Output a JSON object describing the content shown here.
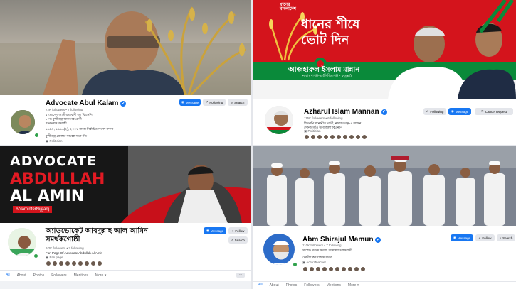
{
  "panels": {
    "p1": {
      "name": "Advocate Abul Kalam",
      "stats": "72K followers • 7 following",
      "bio": [
        "বাংলাদেশ জাতীয়তাবাদী দল বিএনপি",
        "৮ নং মুন্সীগঞ্জ আসনের প্রার্থী",
        "মনোনয়নপ্রত্যাশী"
      ],
      "bio2": "১৯৯১, ১৯৯৬(২), ২০০১ সালে নির্বাচিত সংসদ সদস্য",
      "bio3": "মুন্সীগঞ্জ জেলার সাবেক সভাপতি",
      "category": "Politician",
      "message": "Message",
      "following": "Following",
      "search": "Search"
    },
    "p2": {
      "banner_top": "ধানের শীষে ভোট দিন",
      "banner_name": "আজহারুল ইসলাম মান্নান",
      "banner_sub": "নারায়ণগঞ্জ-৪ (সিদ্ধিরগঞ্জ - ফতুল্লা)",
      "name": "Azharul Islam Mannan",
      "stats": "115K followers • 6 following",
      "bio": "বিএনপি মনোনীত প্রার্থী, নারায়ণগঞ্জ-৪ আসন",
      "bio2": "সোনারগাঁও উপজেলা বিএনপি",
      "category": "Politician",
      "message": "Message",
      "following": "Following",
      "cancel": "Cancel request"
    },
    "p3": {
      "banner_line1": "ADVOCATE",
      "banner_line2": "ABDULLAH",
      "banner_line3": "AL AMIN",
      "hashtag": "#AlaminforNijganj",
      "name": "অ্যাডভোকেট আবদুল্লাহ আল আমিন সমর্থকগোষ্ঠী",
      "stats": "9.2K followers • 2 following",
      "bio": "Fan Page Of Advocate Abdullah Al Amin",
      "category": "Fan page",
      "message": "Message",
      "follow": "Follow",
      "search": "Search",
      "tabs": [
        "All",
        "About",
        "Photos",
        "Followers",
        "Mentions",
        "More"
      ]
    },
    "p4": {
      "name": "Abm Shirajul Mamun",
      "stats": "110K followers • 7 following",
      "bio": "সাবেক সংসদ সদস্য, জামায়াতে ইসলামী",
      "bio2": "কেন্দ্রীয় কর্মপরিষদ সদস্য",
      "category": "Actor/Teacher",
      "message": "Message",
      "follow": "Follow",
      "search": "Search",
      "tabs": [
        "All",
        "About",
        "Photos",
        "Followers",
        "Mentions",
        "More"
      ]
    }
  },
  "colors": {
    "fb_blue": "#1877f2",
    "bnp_red": "#d4141c",
    "bnp_green": "#0a8a3a"
  }
}
